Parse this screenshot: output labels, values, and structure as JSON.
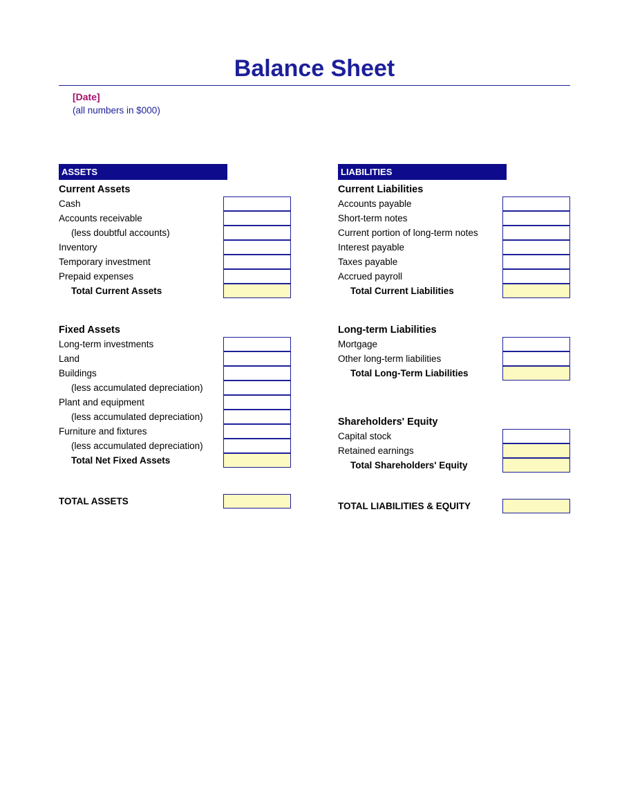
{
  "title": "Balance Sheet",
  "meta": {
    "date_placeholder": "[Date]",
    "units_note": "(all numbers in $000)"
  },
  "left": {
    "header": "ASSETS",
    "sec1": {
      "heading": "Current Assets",
      "r0": "Cash",
      "r1": "Accounts receivable",
      "r2": "(less doubtful accounts)",
      "r3": "Inventory",
      "r4": "Temporary investment",
      "r5": "Prepaid expenses",
      "total": "Total Current Assets"
    },
    "sec2": {
      "heading": "Fixed Assets",
      "r0": "Long-term investments",
      "r1": "Land",
      "r2": "Buildings",
      "r3": "(less accumulated depreciation)",
      "r4": "Plant and equipment",
      "r5": "(less accumulated depreciation)",
      "r6": "Furniture and fixtures",
      "r7": "(less accumulated depreciation)",
      "total": "Total Net Fixed Assets"
    },
    "grand_total": "TOTAL ASSETS"
  },
  "right": {
    "header": "LIABILITIES",
    "sec1": {
      "heading": "Current Liabilities",
      "r0": "Accounts payable",
      "r1": "Short-term notes",
      "r2": "Current portion of long-term notes",
      "r3": "Interest payable",
      "r4": "Taxes payable",
      "r5": "Accrued payroll",
      "total": "Total Current Liabilities"
    },
    "sec2": {
      "heading": "Long-term Liabilities",
      "r0": "Mortgage",
      "r1": "Other long-term liabilities",
      "total": "Total Long-Term Liabilities"
    },
    "sec3": {
      "heading": "Shareholders' Equity",
      "r0": "Capital stock",
      "r1": "Retained earnings",
      "total": "Total Shareholders' Equity"
    },
    "grand_total": "TOTAL LIABILITIES & EQUITY"
  }
}
